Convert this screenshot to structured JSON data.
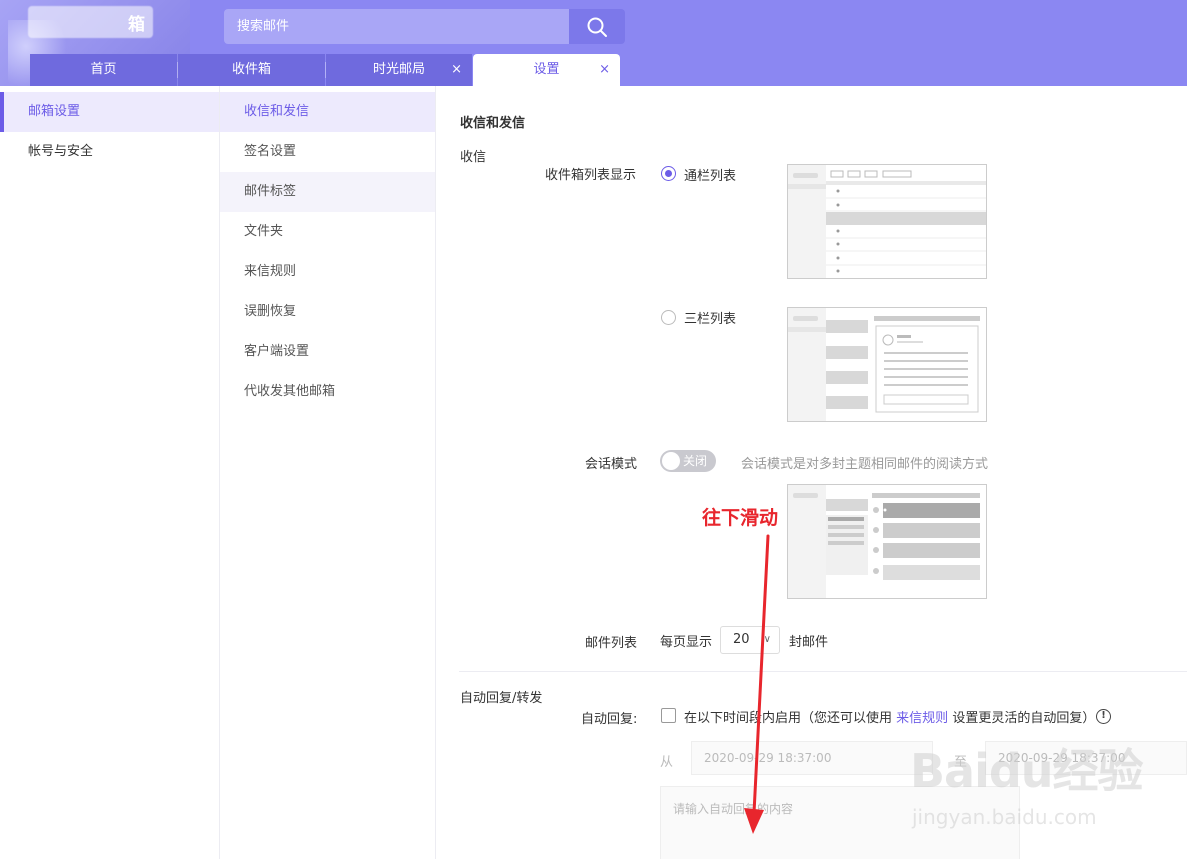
{
  "header": {
    "logo_char": "箱",
    "search_placeholder": "搜索邮件"
  },
  "tabs": [
    {
      "label": "首页"
    },
    {
      "label": "收件箱"
    },
    {
      "label": "时光邮局",
      "close": "×"
    },
    {
      "label": "设置",
      "close": "×"
    }
  ],
  "nav1": {
    "items": [
      {
        "label": "邮箱设置"
      },
      {
        "label": "帐号与安全"
      }
    ]
  },
  "nav2": {
    "items": [
      {
        "label": "收信和发信"
      },
      {
        "label": "签名设置"
      },
      {
        "label": "邮件标签"
      },
      {
        "label": "文件夹"
      },
      {
        "label": "来信规则"
      },
      {
        "label": "误删恢复"
      },
      {
        "label": "客户端设置"
      },
      {
        "label": "代收发其他邮箱"
      }
    ]
  },
  "main": {
    "section_title": "收信和发信",
    "receive_label": "收信",
    "inbox_display_label": "收件箱列表显示",
    "option_full": "通栏列表",
    "option_three": "三栏列表",
    "conversation_label": "会话模式",
    "toggle_text": "关闭",
    "conversation_desc": "会话模式是对多封主题相同邮件的阅读方式",
    "mail_list_label": "邮件列表",
    "per_page_prefix": "每页显示",
    "per_page_value": "20",
    "per_page_suffix": "封邮件",
    "auto_section": "自动回复/转发",
    "auto_reply_label": "自动回复:",
    "auto_reply_text1": "在以下时间段内启用（您还可以使用",
    "auto_reply_link": "来信规则",
    "auto_reply_text2": "设置更灵活的自动回复）",
    "from_label": "从",
    "from_value": "2020-09-29 18:37:00",
    "to_label": "至",
    "to_value": "2020-09-29 18:37:00",
    "content_placeholder": "请输入自动回复的内容"
  },
  "annotation": {
    "text": "往下滑动",
    "color": "#e8262d"
  },
  "watermark": {
    "brand": "Baidu经验",
    "url": "jingyan.baidu.com"
  },
  "colors": {
    "header": "#8b87f2",
    "accent": "#6c5ce7"
  }
}
